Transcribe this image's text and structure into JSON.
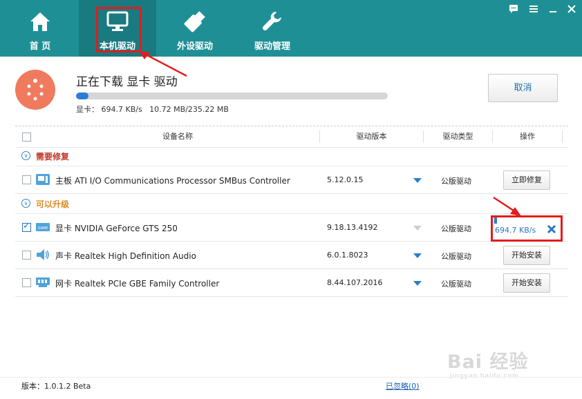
{
  "nav": [
    {
      "label": "首 页",
      "icon": "home-icon"
    },
    {
      "label": "本机驱动",
      "icon": "monitor-icon",
      "active": true
    },
    {
      "label": "外设驱动",
      "icon": "usb-icon"
    },
    {
      "label": "驱动管理",
      "icon": "wrench-icon"
    }
  ],
  "window": {
    "buttons": [
      "feedback-icon",
      "menu-icon",
      "minimize-icon",
      "close-icon"
    ]
  },
  "download": {
    "title": "正在下载 显卡 驱动",
    "info": "显卡： 694.7 KB/s   10.72 MB/235.22 MB",
    "progress": 0.04,
    "cancel_label": "取消"
  },
  "table": {
    "headers": [
      "设备名称",
      "驱动版本",
      "驱动类型",
      "操作"
    ],
    "groups": [
      {
        "label": "需要修复",
        "color": "#c0392b",
        "rows": [
          {
            "name": "主板 ATI I/O Communications Processor SMBus Controller",
            "version": "5.12.0.15",
            "type": "公版驱动",
            "action": "立即修复",
            "checked": false,
            "icon": "motherboard-icon"
          }
        ]
      },
      {
        "label": "可以升级",
        "color": "#e08a1e",
        "rows": [
          {
            "name": "显卡 NVIDIA GeForce GTS 250",
            "version": "9.18.13.4192",
            "type": "公版驱动",
            "speed": "694.7 KB/s",
            "checked": true,
            "icon": "graphics-card-icon"
          },
          {
            "name": "声卡 Realtek High Definition Audio",
            "version": "6.0.1.8023",
            "type": "公版驱动",
            "action": "开始安装",
            "checked": false,
            "icon": "speaker-icon"
          },
          {
            "name": "网卡 Realtek PCIe GBE Family Controller",
            "version": "8.44.107.2016",
            "type": "公版驱动",
            "action": "开始安装",
            "checked": false,
            "icon": "network-card-icon"
          }
        ]
      }
    ]
  },
  "footer": {
    "version": "版本：1.0.1.2 Beta",
    "ignored": "已忽略(0)"
  },
  "watermark": {
    "main": "Bai 经验",
    "sub": "jingyan.baidu.com"
  }
}
